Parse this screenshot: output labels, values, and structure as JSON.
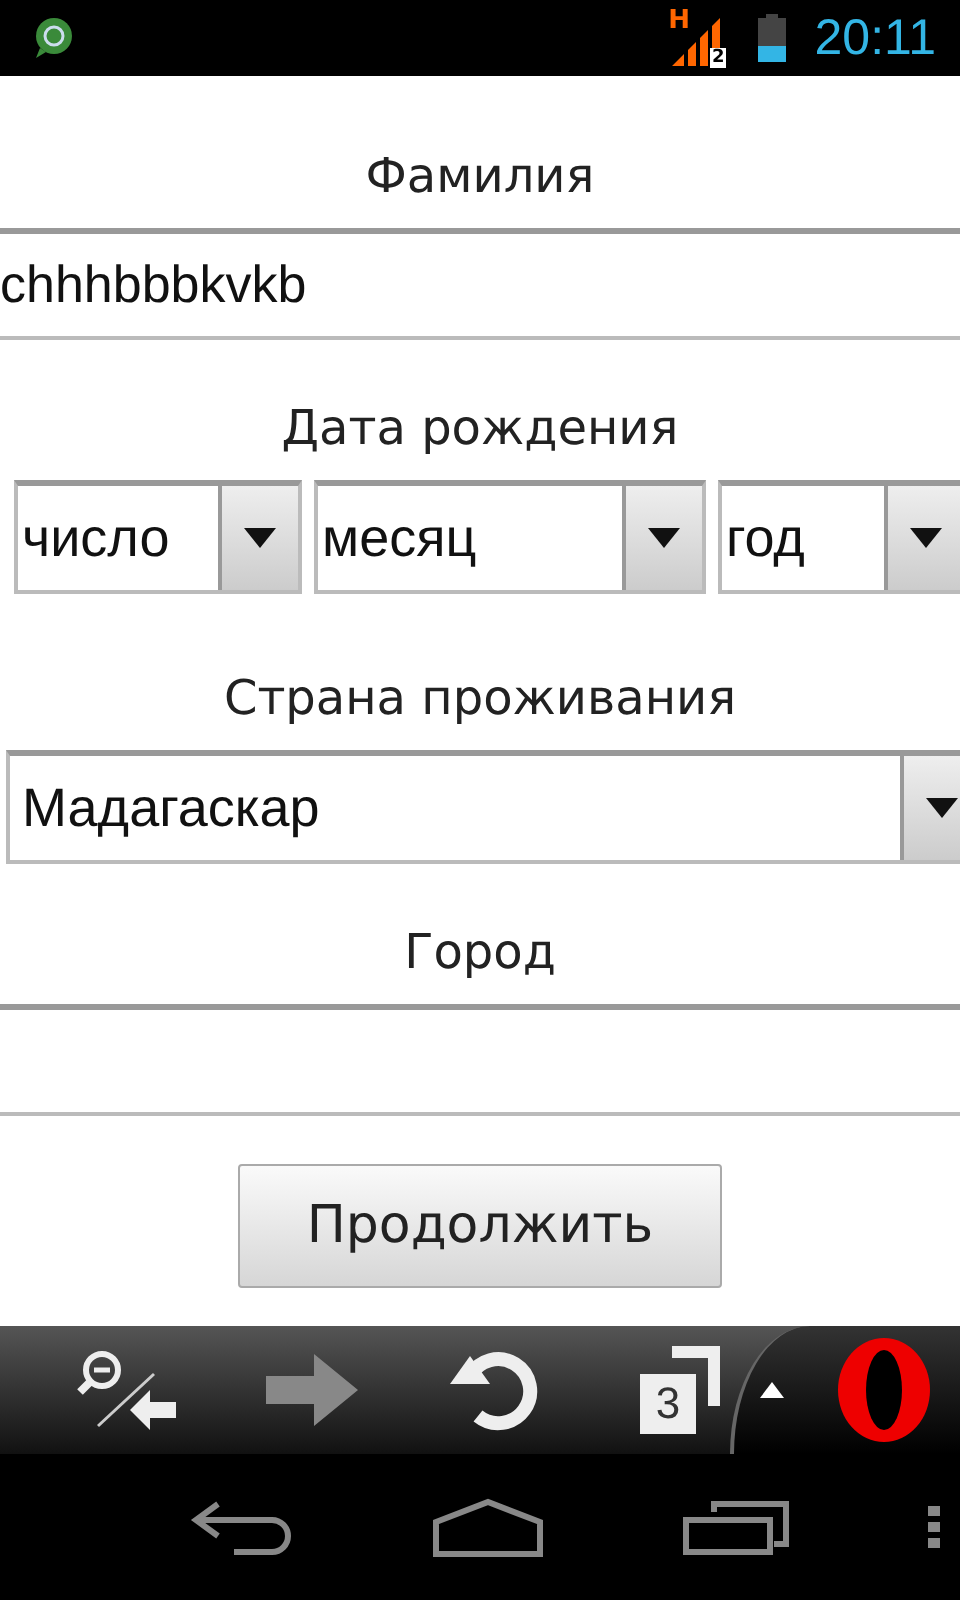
{
  "status_bar": {
    "network": "H",
    "sim_badge": "2",
    "time": "20:11"
  },
  "form": [
    {
      "kind": "text",
      "label": "Фамилия",
      "value": "chhhbbbkvkb"
    },
    {
      "kind": "date",
      "label": "Дата рождения",
      "selects": [
        {
          "value": "число"
        },
        {
          "value": "месяц"
        },
        {
          "value": "год"
        }
      ]
    },
    {
      "kind": "select",
      "label": "Страна проживания",
      "value": "Мадагаскар"
    },
    {
      "kind": "text",
      "label": "Город"
    }
  ],
  "submit": "Продолжить",
  "browser_toolbar": {
    "tab_count": "3"
  }
}
